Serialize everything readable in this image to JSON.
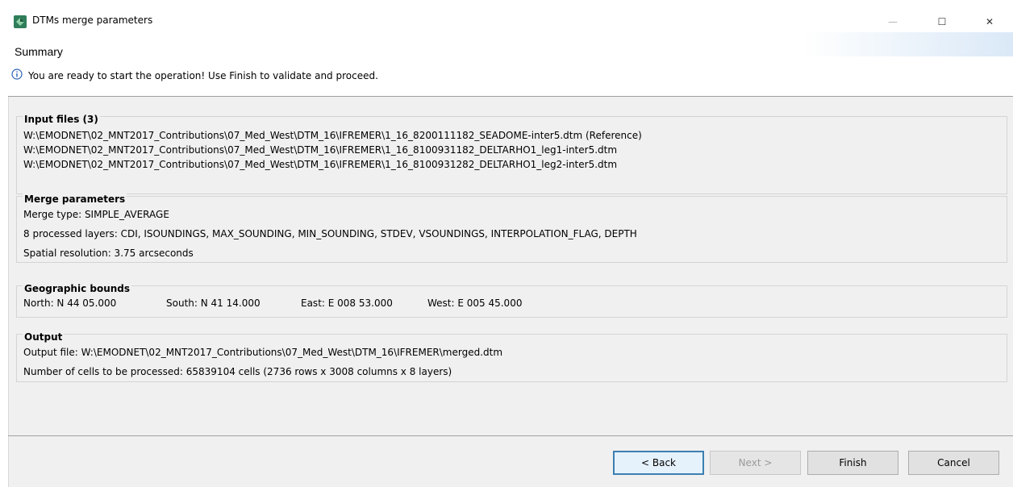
{
  "window": {
    "title": "DTMs merge parameters",
    "minimize_glyph": "—",
    "maximize_glyph": "☐",
    "close_glyph": "✕"
  },
  "header": {
    "title": "Summary",
    "info_message": "You are ready to start the operation! Use Finish to validate and proceed."
  },
  "input_files": {
    "title": "Input files (3)",
    "files": [
      "W:\\EMODNET\\02_MNT2017_Contributions\\07_Med_West\\DTM_16\\IFREMER\\1_16_8200111182_SEADOME-inter5.dtm (Reference)",
      "W:\\EMODNET\\02_MNT2017_Contributions\\07_Med_West\\DTM_16\\IFREMER\\1_16_8100931182_DELTARHO1_leg1-inter5.dtm",
      "W:\\EMODNET\\02_MNT2017_Contributions\\07_Med_West\\DTM_16\\IFREMER\\1_16_8100931282_DELTARHO1_leg2-inter5.dtm"
    ]
  },
  "merge_parameters": {
    "title": "Merge parameters",
    "merge_type": "Merge type: SIMPLE_AVERAGE",
    "layers": "8 processed layers: CDI, ISOUNDINGS, MAX_SOUNDING, MIN_SOUNDING, STDEV, VSOUNDINGS, INTERPOLATION_FLAG, DEPTH",
    "resolution": "Spatial resolution: 3.75 arcseconds"
  },
  "geographic_bounds": {
    "title": "Geographic bounds",
    "north": "North: N 44 05.000",
    "south": "South: N 41 14.000",
    "east": "East: E 008 53.000",
    "west": "West: E 005 45.000"
  },
  "output": {
    "title": "Output",
    "file": "Output file: W:\\EMODNET\\02_MNT2017_Contributions\\07_Med_West\\DTM_16\\IFREMER\\merged.dtm",
    "cells": "Number of cells to be processed: 65839104 cells (2736 rows x 3008 columns x 8 layers)"
  },
  "buttons": {
    "back": "< Back",
    "next": "Next >",
    "finish": "Finish",
    "cancel": "Cancel"
  },
  "colors": {
    "accent": "#3c7fb1",
    "panel_bg": "#f0f0f0",
    "app_icon_green": "#2e8b57"
  }
}
